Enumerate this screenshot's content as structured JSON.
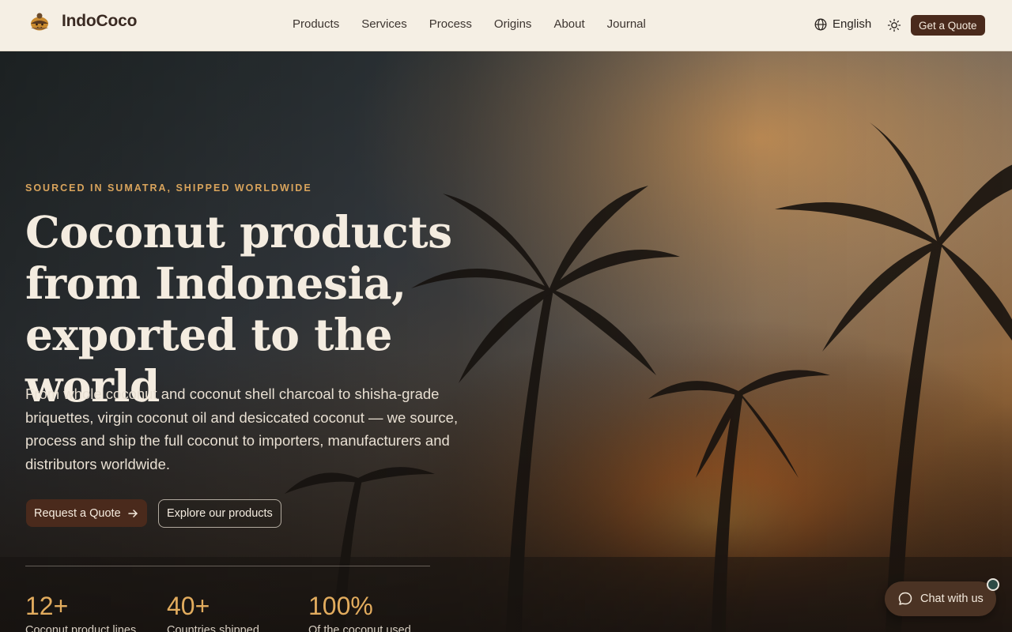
{
  "brand": {
    "name": "IndoCoco",
    "logo_icon": "coconut-logo-icon"
  },
  "nav": {
    "items": [
      {
        "label": "Products"
      },
      {
        "label": "Services"
      },
      {
        "label": "Process"
      },
      {
        "label": "Origins"
      },
      {
        "label": "About"
      },
      {
        "label": "Journal"
      }
    ]
  },
  "header": {
    "language_label": "English",
    "quote_label": "Get a Quote"
  },
  "hero": {
    "eyebrow": "SOURCED IN SUMATRA, SHIPPED WORLDWIDE",
    "headline_lines": [
      "Coconut products",
      "from Indonesia,",
      "exported to the world"
    ],
    "lead": "From whole coconut and coconut shell charcoal to shisha-grade briquettes, virgin coconut oil and desiccated coconut — we source, process and ship the full coconut to importers, manufacturers and distributors worldwide.",
    "primary_cta": "Request a Quote",
    "secondary_cta": "Explore our products"
  },
  "stats": [
    {
      "value": "12+",
      "label": "Coconut product lines"
    },
    {
      "value": "40+",
      "label": "Countries shipped"
    },
    {
      "value": "100%",
      "label": "Of the coconut used"
    }
  ],
  "chat": {
    "label": "Chat with us"
  },
  "colors": {
    "accent": "#e2ac5e",
    "brand_dark": "#4a2a1c",
    "header_bg": "#f5efe4"
  }
}
